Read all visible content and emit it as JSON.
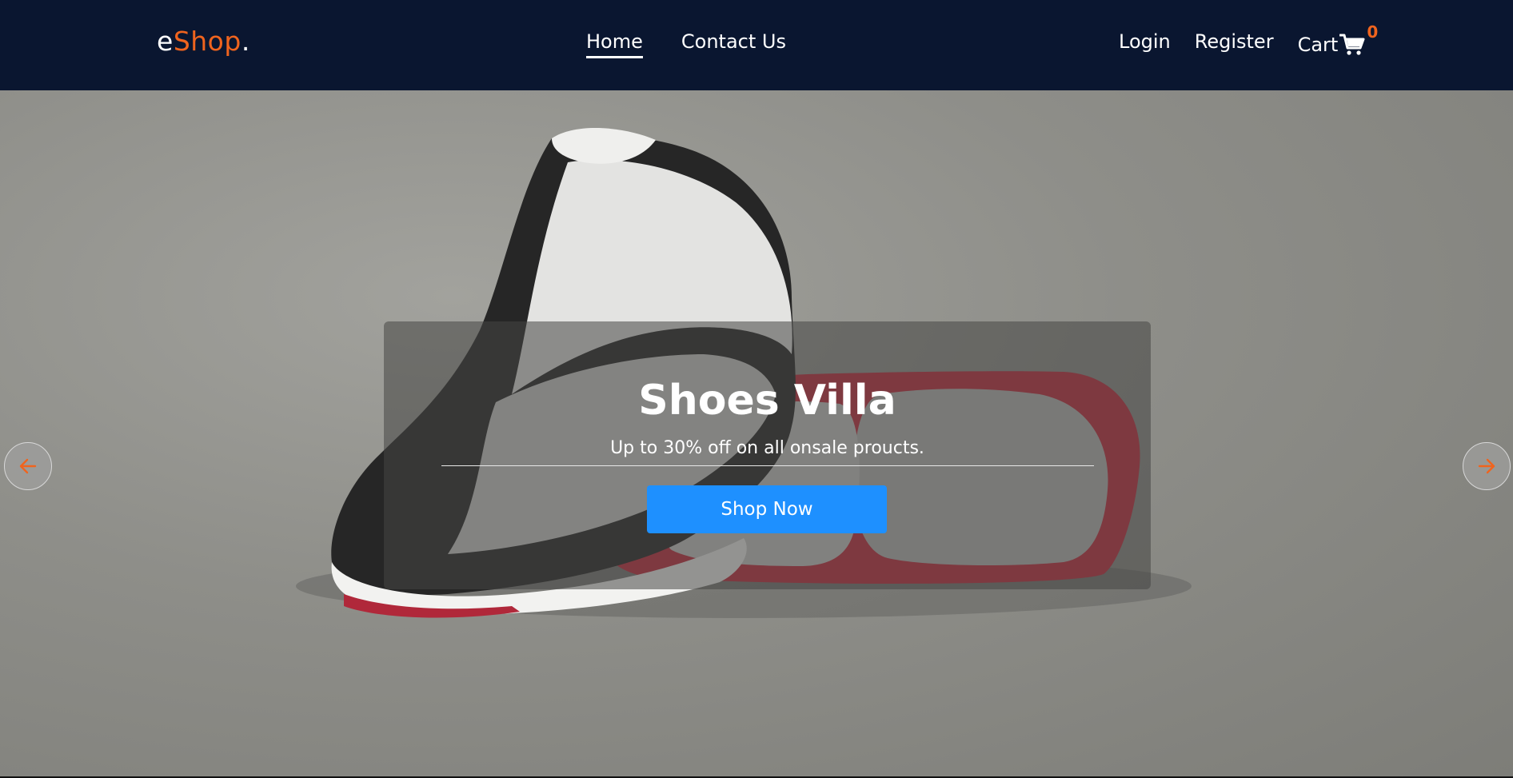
{
  "brand": {
    "prefix": "e",
    "name": "Shop",
    "suffix": ".",
    "accent_color": "#f0641e"
  },
  "nav": {
    "links": [
      {
        "label": "Home",
        "active": true
      },
      {
        "label": "Contact Us",
        "active": false
      }
    ],
    "login_label": "Login",
    "register_label": "Register",
    "cart_label": "Cart",
    "cart_count": "0",
    "cart_icon": "shopping-cart-icon"
  },
  "hero": {
    "title": "Shoes Villa",
    "subtitle": "Up to 30% off on all onsale proucts.",
    "cta_label": "Shop Now",
    "cta_color": "#1e90ff",
    "prev_icon": "arrow-left-icon",
    "next_icon": "arrow-right-icon"
  },
  "colors": {
    "header_bg": "#0a1630",
    "text": "#ffffff"
  }
}
